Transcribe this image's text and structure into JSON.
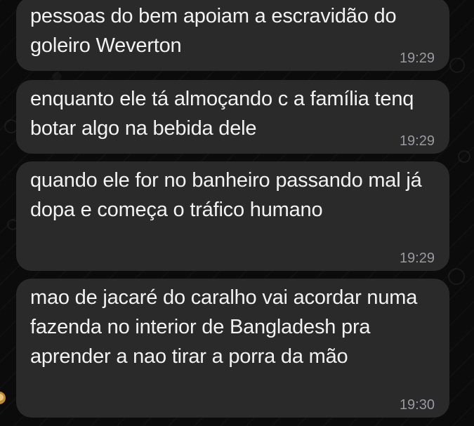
{
  "chat": {
    "messages": [
      {
        "text": "pessoas do bem apoiam a escravidão do goleiro Weverton",
        "time": "19:29"
      },
      {
        "text": "enquanto ele tá almoçando c a família tenq botar algo na bebida dele",
        "time": "19:29"
      },
      {
        "text": "quando ele for no banheiro passando mal já dopa e começa o tráfico humano",
        "time": "19:29"
      },
      {
        "text": "mao de jacaré do caralho vai acordar numa fazenda no interior de Bangladesh pra aprender a nao tirar a porra da mão",
        "time": "19:30"
      }
    ]
  },
  "colors": {
    "background": "#0b0b0b",
    "bubble": "#2a2a2b",
    "text": "#f2f2f2",
    "timestamp": "#9a9a9d"
  }
}
